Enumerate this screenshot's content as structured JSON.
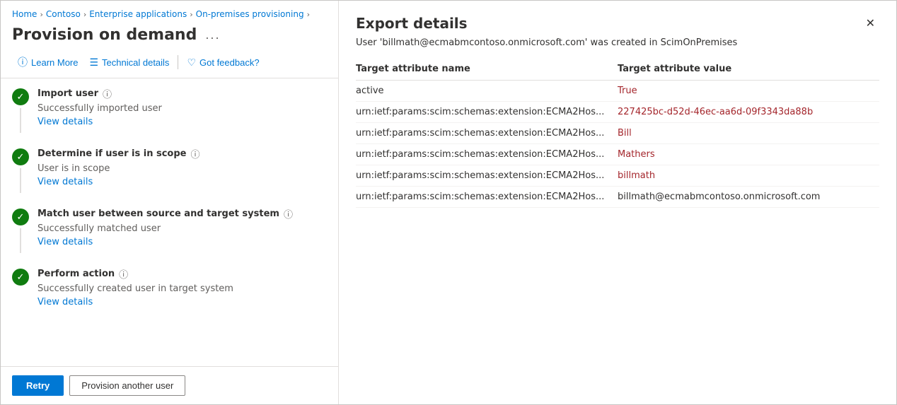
{
  "breadcrumb": {
    "items": [
      {
        "label": "Home",
        "href": "#"
      },
      {
        "label": "Contoso",
        "href": "#"
      },
      {
        "label": "Enterprise applications",
        "href": "#"
      },
      {
        "label": "On-premises provisioning",
        "href": "#"
      }
    ]
  },
  "page": {
    "title": "Provision on demand",
    "ellipsis": "..."
  },
  "toolbar": {
    "learn_more": "Learn More",
    "technical_details": "Technical details",
    "got_feedback": "Got feedback?"
  },
  "steps": [
    {
      "title": "Import user",
      "description": "Successfully imported user",
      "view_details": "View details"
    },
    {
      "title": "Determine if user is in scope",
      "description": "User is in scope",
      "view_details": "View details"
    },
    {
      "title": "Match user between source and target system",
      "description": "Successfully matched user",
      "view_details": "View details"
    },
    {
      "title": "Perform action",
      "description": "Successfully created user in target system",
      "view_details": "View details"
    }
  ],
  "buttons": {
    "retry": "Retry",
    "provision_another": "Provision another user"
  },
  "export_panel": {
    "title": "Export details",
    "subtitle": "User 'billmath@ecmabmcontoso.onmicrosoft.com' was created in ScimOnPremises",
    "table": {
      "col1": "Target attribute name",
      "col2": "Target attribute value",
      "rows": [
        {
          "attr": "active",
          "value": "True",
          "value_style": "red"
        },
        {
          "attr": "urn:ietf:params:scim:schemas:extension:ECMA2Hos...",
          "value": "227425bc-d52d-46ec-aa6d-09f3343da88b",
          "value_style": "red"
        },
        {
          "attr": "urn:ietf:params:scim:schemas:extension:ECMA2Hos...",
          "value": "Bill",
          "value_style": "red"
        },
        {
          "attr": "urn:ietf:params:scim:schemas:extension:ECMA2Hos...",
          "value": "Mathers",
          "value_style": "red"
        },
        {
          "attr": "urn:ietf:params:scim:schemas:extension:ECMA2Hos...",
          "value": "billmath",
          "value_style": "red"
        },
        {
          "attr": "urn:ietf:params:scim:schemas:extension:ECMA2Hos...",
          "value": "billmath@ecmabmcontoso.onmicrosoft.com",
          "value_style": "dark"
        }
      ]
    }
  }
}
